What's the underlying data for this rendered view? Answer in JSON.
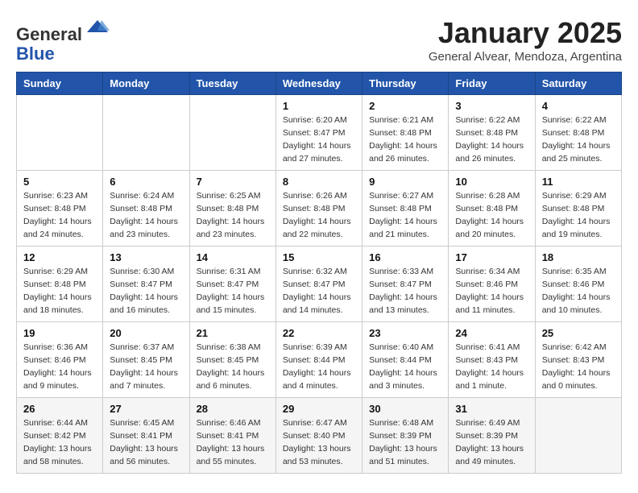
{
  "header": {
    "logo_general": "General",
    "logo_blue": "Blue",
    "month_title": "January 2025",
    "subtitle": "General Alvear, Mendoza, Argentina"
  },
  "weekdays": [
    "Sunday",
    "Monday",
    "Tuesday",
    "Wednesday",
    "Thursday",
    "Friday",
    "Saturday"
  ],
  "weeks": [
    [
      {
        "day": "",
        "info": ""
      },
      {
        "day": "",
        "info": ""
      },
      {
        "day": "",
        "info": ""
      },
      {
        "day": "1",
        "info": "Sunrise: 6:20 AM\nSunset: 8:47 PM\nDaylight: 14 hours\nand 27 minutes."
      },
      {
        "day": "2",
        "info": "Sunrise: 6:21 AM\nSunset: 8:48 PM\nDaylight: 14 hours\nand 26 minutes."
      },
      {
        "day": "3",
        "info": "Sunrise: 6:22 AM\nSunset: 8:48 PM\nDaylight: 14 hours\nand 26 minutes."
      },
      {
        "day": "4",
        "info": "Sunrise: 6:22 AM\nSunset: 8:48 PM\nDaylight: 14 hours\nand 25 minutes."
      }
    ],
    [
      {
        "day": "5",
        "info": "Sunrise: 6:23 AM\nSunset: 8:48 PM\nDaylight: 14 hours\nand 24 minutes."
      },
      {
        "day": "6",
        "info": "Sunrise: 6:24 AM\nSunset: 8:48 PM\nDaylight: 14 hours\nand 23 minutes."
      },
      {
        "day": "7",
        "info": "Sunrise: 6:25 AM\nSunset: 8:48 PM\nDaylight: 14 hours\nand 23 minutes."
      },
      {
        "day": "8",
        "info": "Sunrise: 6:26 AM\nSunset: 8:48 PM\nDaylight: 14 hours\nand 22 minutes."
      },
      {
        "day": "9",
        "info": "Sunrise: 6:27 AM\nSunset: 8:48 PM\nDaylight: 14 hours\nand 21 minutes."
      },
      {
        "day": "10",
        "info": "Sunrise: 6:28 AM\nSunset: 8:48 PM\nDaylight: 14 hours\nand 20 minutes."
      },
      {
        "day": "11",
        "info": "Sunrise: 6:29 AM\nSunset: 8:48 PM\nDaylight: 14 hours\nand 19 minutes."
      }
    ],
    [
      {
        "day": "12",
        "info": "Sunrise: 6:29 AM\nSunset: 8:48 PM\nDaylight: 14 hours\nand 18 minutes."
      },
      {
        "day": "13",
        "info": "Sunrise: 6:30 AM\nSunset: 8:47 PM\nDaylight: 14 hours\nand 16 minutes."
      },
      {
        "day": "14",
        "info": "Sunrise: 6:31 AM\nSunset: 8:47 PM\nDaylight: 14 hours\nand 15 minutes."
      },
      {
        "day": "15",
        "info": "Sunrise: 6:32 AM\nSunset: 8:47 PM\nDaylight: 14 hours\nand 14 minutes."
      },
      {
        "day": "16",
        "info": "Sunrise: 6:33 AM\nSunset: 8:47 PM\nDaylight: 14 hours\nand 13 minutes."
      },
      {
        "day": "17",
        "info": "Sunrise: 6:34 AM\nSunset: 8:46 PM\nDaylight: 14 hours\nand 11 minutes."
      },
      {
        "day": "18",
        "info": "Sunrise: 6:35 AM\nSunset: 8:46 PM\nDaylight: 14 hours\nand 10 minutes."
      }
    ],
    [
      {
        "day": "19",
        "info": "Sunrise: 6:36 AM\nSunset: 8:46 PM\nDaylight: 14 hours\nand 9 minutes."
      },
      {
        "day": "20",
        "info": "Sunrise: 6:37 AM\nSunset: 8:45 PM\nDaylight: 14 hours\nand 7 minutes."
      },
      {
        "day": "21",
        "info": "Sunrise: 6:38 AM\nSunset: 8:45 PM\nDaylight: 14 hours\nand 6 minutes."
      },
      {
        "day": "22",
        "info": "Sunrise: 6:39 AM\nSunset: 8:44 PM\nDaylight: 14 hours\nand 4 minutes."
      },
      {
        "day": "23",
        "info": "Sunrise: 6:40 AM\nSunset: 8:44 PM\nDaylight: 14 hours\nand 3 minutes."
      },
      {
        "day": "24",
        "info": "Sunrise: 6:41 AM\nSunset: 8:43 PM\nDaylight: 14 hours\nand 1 minute."
      },
      {
        "day": "25",
        "info": "Sunrise: 6:42 AM\nSunset: 8:43 PM\nDaylight: 14 hours\nand 0 minutes."
      }
    ],
    [
      {
        "day": "26",
        "info": "Sunrise: 6:44 AM\nSunset: 8:42 PM\nDaylight: 13 hours\nand 58 minutes."
      },
      {
        "day": "27",
        "info": "Sunrise: 6:45 AM\nSunset: 8:41 PM\nDaylight: 13 hours\nand 56 minutes."
      },
      {
        "day": "28",
        "info": "Sunrise: 6:46 AM\nSunset: 8:41 PM\nDaylight: 13 hours\nand 55 minutes."
      },
      {
        "day": "29",
        "info": "Sunrise: 6:47 AM\nSunset: 8:40 PM\nDaylight: 13 hours\nand 53 minutes."
      },
      {
        "day": "30",
        "info": "Sunrise: 6:48 AM\nSunset: 8:39 PM\nDaylight: 13 hours\nand 51 minutes."
      },
      {
        "day": "31",
        "info": "Sunrise: 6:49 AM\nSunset: 8:39 PM\nDaylight: 13 hours\nand 49 minutes."
      },
      {
        "day": "",
        "info": ""
      }
    ]
  ]
}
